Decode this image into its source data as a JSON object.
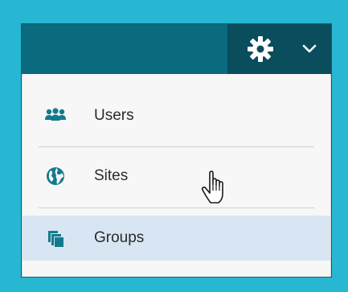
{
  "colors": {
    "frame": "#28b7d2",
    "header": "#0a6a7e",
    "settings_trigger": "#0a4d5c",
    "menu_bg": "#f7f7f7",
    "hover_bg": "#d7e6f2",
    "icon": "#127a8f",
    "text": "#2a2a2a"
  },
  "header": {
    "settings_icon": "gear-icon",
    "dropdown_icon": "chevron-down-icon"
  },
  "menu": {
    "items": [
      {
        "label": "Users",
        "icon": "users-icon"
      },
      {
        "label": "Sites",
        "icon": "globe-icon"
      },
      {
        "label": "Groups",
        "icon": "stacked-pages-icon",
        "hovered": true
      }
    ]
  },
  "cursor": {
    "icon": "hand-pointer-icon"
  }
}
